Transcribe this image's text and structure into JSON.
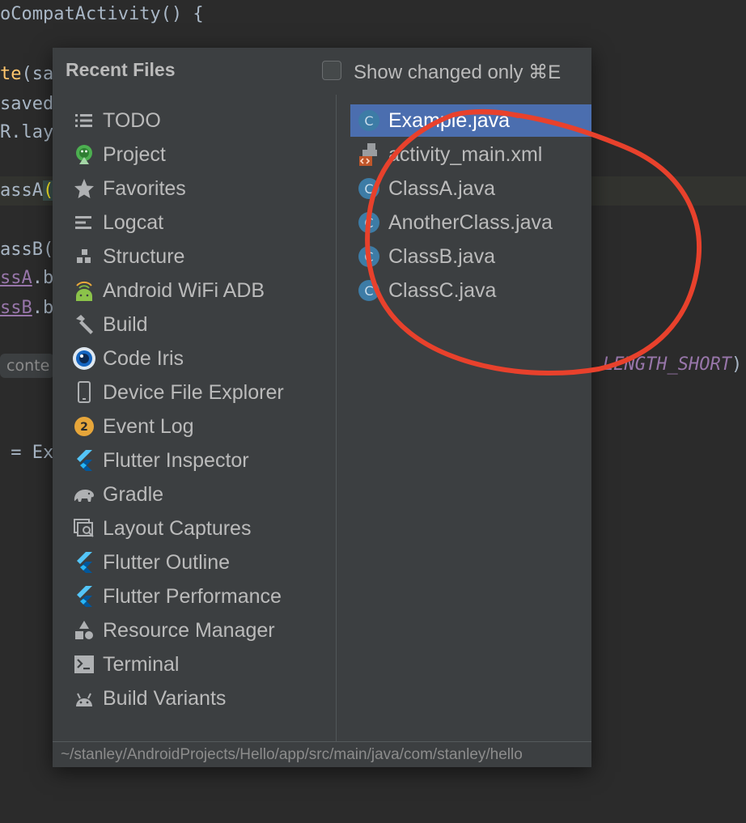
{
  "editor": {
    "line1": "oCompatActivity() {",
    "line2_fn": "te",
    "line2_rest": "(sa",
    "line3": "saved",
    "line4": "R.lay",
    "line5_pre": "assA",
    "line5_paren": "(",
    "line6": "assB(",
    "line7_field": "ssA",
    "line7_rest": ".b",
    "line8_field": "ssB",
    "line8_rest": ".b",
    "context_chip": "conte",
    "line_ex": " = Ex",
    "constant": "LENGTH_SHORT",
    "constant_tail": ")"
  },
  "popup": {
    "title": "Recent Files",
    "show_changed_label": "Show changed only ⌘E",
    "show_changed_checked": false,
    "tool_windows": [
      {
        "label": "TODO",
        "icon": "list-icon"
      },
      {
        "label": "Project",
        "icon": "android-project-icon"
      },
      {
        "label": "Favorites",
        "icon": "star-icon"
      },
      {
        "label": "Logcat",
        "icon": "logcat-icon"
      },
      {
        "label": "Structure",
        "icon": "structure-icon"
      },
      {
        "label": "Android WiFi ADB",
        "icon": "android-wifi-icon"
      },
      {
        "label": "Build",
        "icon": "hammer-icon"
      },
      {
        "label": "Code Iris",
        "icon": "eye-icon"
      },
      {
        "label": "Device File Explorer",
        "icon": "phone-icon"
      },
      {
        "label": "Event Log",
        "icon": "event-log-badge-icon",
        "badge": "2"
      },
      {
        "label": "Flutter Inspector",
        "icon": "flutter-icon"
      },
      {
        "label": "Gradle",
        "icon": "elephant-icon"
      },
      {
        "label": "Layout Captures",
        "icon": "layout-capture-icon"
      },
      {
        "label": "Flutter Outline",
        "icon": "flutter-icon"
      },
      {
        "label": "Flutter Performance",
        "icon": "flutter-icon"
      },
      {
        "label": "Resource Manager",
        "icon": "shapes-icon"
      },
      {
        "label": "Terminal",
        "icon": "terminal-icon"
      },
      {
        "label": "Build Variants",
        "icon": "android-icon"
      }
    ],
    "files": [
      {
        "label": "Example.java",
        "icon": "java-class-icon",
        "selected": true
      },
      {
        "label": "activity_main.xml",
        "icon": "layout-xml-icon",
        "selected": false
      },
      {
        "label": "ClassA.java",
        "icon": "java-class-icon",
        "selected": false
      },
      {
        "label": "AnotherClass.java",
        "icon": "java-class-icon",
        "selected": false
      },
      {
        "label": "ClassB.java",
        "icon": "java-class-icon",
        "selected": false
      },
      {
        "label": "ClassC.java",
        "icon": "java-class-icon",
        "selected": false
      }
    ],
    "class_letter": "C",
    "path": "~/stanley/AndroidProjects/Hello/app/src/main/java/com/stanley/hello"
  },
  "colors": {
    "editor_bg": "#2b2b2b",
    "popup_bg": "#3c3f41",
    "selection": "#4b6eaf",
    "annotation_circle": "#e8412c"
  }
}
